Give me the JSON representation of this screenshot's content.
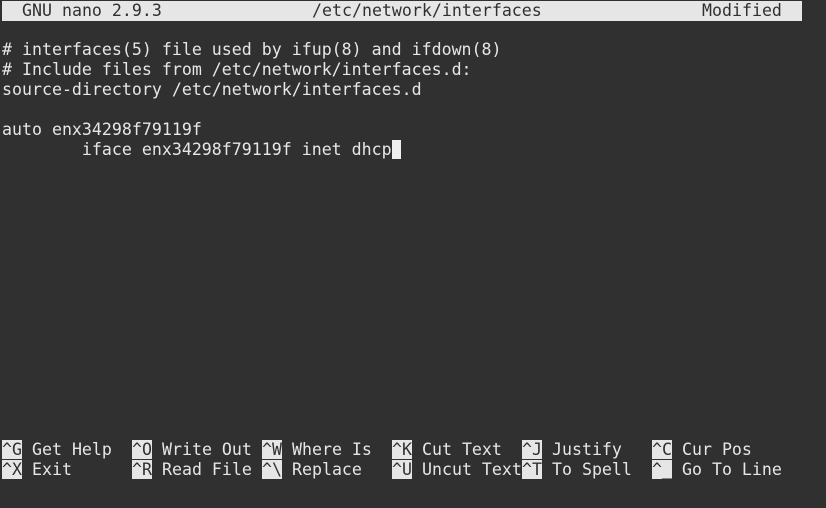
{
  "titlebar": {
    "app": "GNU nano 2.9.3",
    "file": "/etc/network/interfaces",
    "status": "Modified"
  },
  "editor": {
    "lines": [
      "# interfaces(5) file used by ifup(8) and ifdown(8)",
      "# Include files from /etc/network/interfaces.d:",
      "source-directory /etc/network/interfaces.d",
      "",
      "auto enx34298f79119f",
      "        iface enx34298f79119f inet dhcp"
    ]
  },
  "shortcuts": [
    {
      "key": "^G",
      "label": "Get Help"
    },
    {
      "key": "^O",
      "label": "Write Out"
    },
    {
      "key": "^W",
      "label": "Where Is"
    },
    {
      "key": "^K",
      "label": "Cut Text"
    },
    {
      "key": "^J",
      "label": "Justify"
    },
    {
      "key": "^C",
      "label": "Cur Pos"
    },
    {
      "key": "^X",
      "label": "Exit"
    },
    {
      "key": "^R",
      "label": "Read File"
    },
    {
      "key": "^\\",
      "label": "Replace"
    },
    {
      "key": "^U",
      "label": "Uncut Text"
    },
    {
      "key": "^T",
      "label": "To Spell"
    },
    {
      "key": "^_",
      "label": "Go To Line"
    }
  ]
}
